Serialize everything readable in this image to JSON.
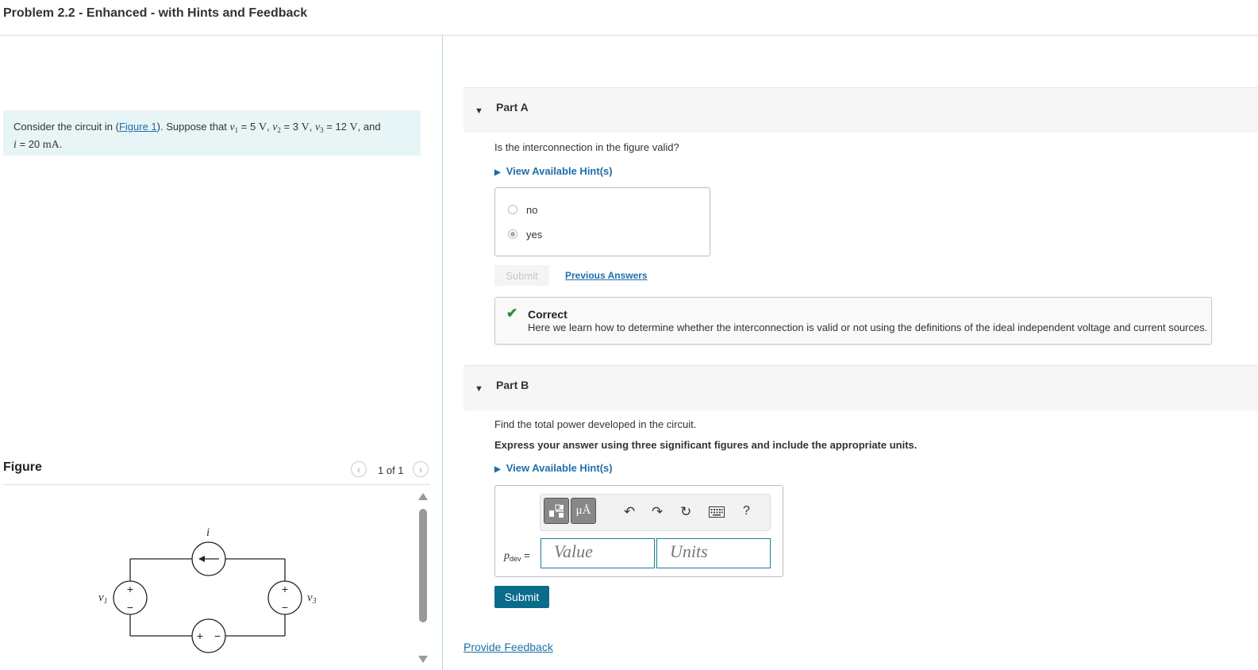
{
  "header": {
    "title": "Problem 2.2 - Enhanced - with Hints and Feedback"
  },
  "problem": {
    "intro": "Consider the circuit in (",
    "figure_link": "Figure 1",
    "text_after_link": "). Suppose that ",
    "v1_var": "v",
    "v1_sub": "1",
    "v1_value": " = 5 ",
    "v2_var": "v",
    "v2_sub": "2",
    "v2_value": " = 3 ",
    "v3_var": "v",
    "v3_sub": "3",
    "v3_value": " = 12 ",
    "volt_unit": "V",
    "sep": ", ",
    "and": ", and",
    "i_var": "i",
    "i_value": " = 20 ",
    "i_unit": "mA",
    "end": "."
  },
  "figure": {
    "title": "Figure",
    "pager": "1 of 1",
    "prev_icon": "chevron-left-icon",
    "next_icon": "chevron-right-icon",
    "labels": {
      "i": "i",
      "v1": "v",
      "v1_sub": "1",
      "v3": "v",
      "v3_sub": "3",
      "plus": "+",
      "minus": "−"
    }
  },
  "partA": {
    "title": "Part A",
    "question": "Is the interconnection in the figure valid?",
    "hint_link": "View Available Hint(s)",
    "choices": [
      {
        "label": "no",
        "selected": false
      },
      {
        "label": "yes",
        "selected": true
      }
    ],
    "submit_label": "Submit",
    "previous_answers": "Previous Answers",
    "feedback": {
      "title": "Correct",
      "message": "Here we learn how to determine whether the interconnection is valid or not using the definitions of the ideal independent voltage and current sources."
    }
  },
  "partB": {
    "title": "Part B",
    "question": "Find the total power developed in the circuit.",
    "instruction": "Express your answer using three significant figures and include the appropriate units.",
    "hint_link": "View Available Hint(s)",
    "toolbar": {
      "template_icon": "template-icon",
      "units_label": "μÅ",
      "undo_icon": "undo-icon",
      "redo_icon": "redo-icon",
      "reset_icon": "reset-icon",
      "keyboard_icon": "keyboard-icon",
      "help_label": "?"
    },
    "variable": "p",
    "variable_sub": "dev",
    "equals": " =",
    "value_placeholder": "Value",
    "units_placeholder": "Units",
    "submit_label": "Submit"
  },
  "footer": {
    "provide_feedback": "Provide Feedback"
  }
}
